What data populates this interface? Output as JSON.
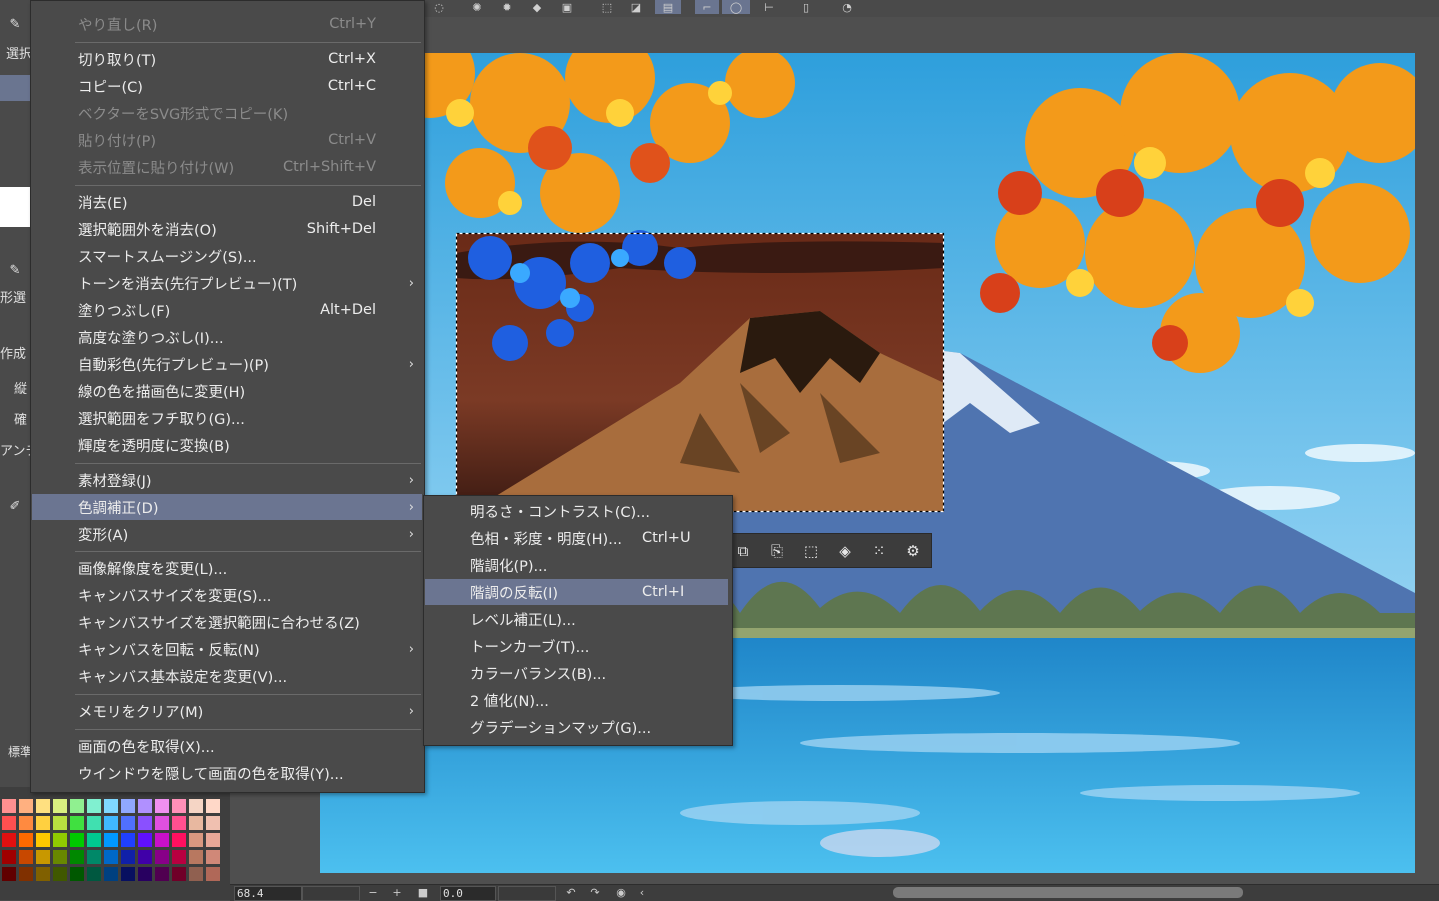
{
  "toolbar": {
    "icons": [
      "lasso-icon",
      "sparkle-icon",
      "spray-icon",
      "fill-icon",
      "transform-icon",
      "select-rect-icon",
      "select-invert-icon",
      "select-area-icon",
      "ellipse-select-icon",
      "rotate-select-icon",
      "flip-icon",
      "phone-icon",
      "chat-icon"
    ]
  },
  "left_panel": {
    "items": [
      "選択",
      "形選",
      "作成",
      "縦",
      "確",
      "アンチ",
      "標準"
    ]
  },
  "main_menu": {
    "items": [
      {
        "label": "やり直し(R)",
        "shortcut": "Ctrl+Y",
        "disabled": true
      },
      {
        "label": "切り取り(T)",
        "shortcut": "Ctrl+X",
        "disabled": false
      },
      {
        "label": "コピー(C)",
        "shortcut": "Ctrl+C",
        "disabled": false
      },
      {
        "label": "ベクターをSVG形式でコピー(K)",
        "shortcut": "",
        "disabled": true
      },
      {
        "label": "貼り付け(P)",
        "shortcut": "Ctrl+V",
        "disabled": true
      },
      {
        "label": "表示位置に貼り付け(W)",
        "shortcut": "Ctrl+Shift+V",
        "disabled": true
      },
      {
        "label": "消去(E)",
        "shortcut": "Del",
        "disabled": false
      },
      {
        "label": "選択範囲外を消去(O)",
        "shortcut": "Shift+Del",
        "disabled": false
      },
      {
        "label": "スマートスムージング(S)...",
        "shortcut": "",
        "disabled": false
      },
      {
        "label": "トーンを消去(先行プレビュー)(T)",
        "shortcut": "",
        "disabled": false,
        "submenu": true
      },
      {
        "label": "塗りつぶし(F)",
        "shortcut": "Alt+Del",
        "disabled": false
      },
      {
        "label": "高度な塗りつぶし(I)...",
        "shortcut": "",
        "disabled": false
      },
      {
        "label": "自動彩色(先行プレビュー)(P)",
        "shortcut": "",
        "disabled": false,
        "submenu": true
      },
      {
        "label": "線の色を描画色に変更(H)",
        "shortcut": "",
        "disabled": false
      },
      {
        "label": "選択範囲をフチ取り(G)...",
        "shortcut": "",
        "disabled": false
      },
      {
        "label": "輝度を透明度に変換(B)",
        "shortcut": "",
        "disabled": false
      },
      {
        "label": "素材登録(J)",
        "shortcut": "",
        "disabled": false,
        "submenu": true
      },
      {
        "label": "色調補正(D)",
        "shortcut": "",
        "disabled": false,
        "submenu": true,
        "highlighted": true
      },
      {
        "label": "変形(A)",
        "shortcut": "",
        "disabled": false,
        "submenu": true
      },
      {
        "label": "画像解像度を変更(L)...",
        "shortcut": "",
        "disabled": false
      },
      {
        "label": "キャンバスサイズを変更(S)...",
        "shortcut": "",
        "disabled": false
      },
      {
        "label": "キャンバスサイズを選択範囲に合わせる(Z)",
        "shortcut": "",
        "disabled": false
      },
      {
        "label": "キャンバスを回転・反転(N)",
        "shortcut": "",
        "disabled": false,
        "submenu": true
      },
      {
        "label": "キャンバス基本設定を変更(V)...",
        "shortcut": "",
        "disabled": false
      },
      {
        "label": "メモリをクリア(M)",
        "shortcut": "",
        "disabled": false,
        "submenu": true
      },
      {
        "label": "画面の色を取得(X)...",
        "shortcut": "",
        "disabled": false
      },
      {
        "label": "ウインドウを隠して画面の色を取得(Y)...",
        "shortcut": "",
        "disabled": false
      }
    ],
    "arrow": "›"
  },
  "submenu": {
    "items": [
      {
        "label": "明るさ・コントラスト(C)...",
        "shortcut": ""
      },
      {
        "label": "色相・彩度・明度(H)...",
        "shortcut": "Ctrl+U"
      },
      {
        "label": "階調化(P)...",
        "shortcut": ""
      },
      {
        "label": "階調の反転(I)",
        "shortcut": "Ctrl+I",
        "highlighted": true
      },
      {
        "label": "レベル補正(L)...",
        "shortcut": ""
      },
      {
        "label": "トーンカーブ(T)...",
        "shortcut": ""
      },
      {
        "label": "カラーバランス(B)...",
        "shortcut": ""
      },
      {
        "label": "2 値化(N)...",
        "shortcut": ""
      },
      {
        "label": "グラデーションマップ(G)...",
        "shortcut": ""
      }
    ]
  },
  "bottom_bar": {
    "zoom": "68.4",
    "rotation": "0.0"
  },
  "colors": {
    "menu_bg": "#4a4a4a",
    "highlight": "#6b7591",
    "sky": "#3aa7df",
    "water": "#2a8fd0",
    "mountain": "#4f74b0"
  }
}
